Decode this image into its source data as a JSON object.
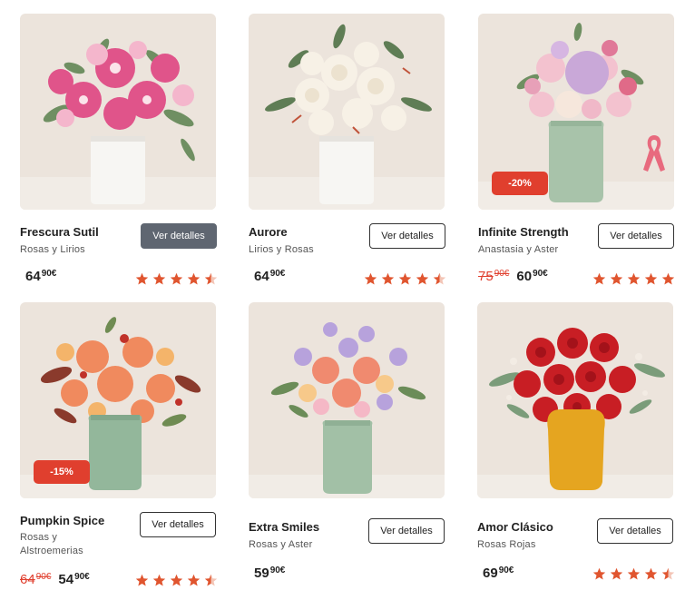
{
  "colors": {
    "accent": "#e03f2e",
    "star": "#e0552f",
    "button_active": "#5f6671"
  },
  "products": [
    {
      "title": "Frescura Sutil",
      "subtitle": "Rosas y Lirios",
      "button": "Ver detalles",
      "button_active": true,
      "price": {
        "int": "64",
        "cents": "90€"
      },
      "rating": 4.5,
      "vase": "white",
      "flowers": "pink-lilies"
    },
    {
      "title": "Aurore",
      "subtitle": "Lirios y Rosas",
      "button": "Ver detalles",
      "button_active": false,
      "price": {
        "int": "64",
        "cents": "90€"
      },
      "rating": 4.5,
      "vase": "white",
      "flowers": "white-roses"
    },
    {
      "title": "Infinite Strength",
      "subtitle": "Anastasia y Aster",
      "button": "Ver detalles",
      "button_active": false,
      "badge": "-20%",
      "old_price": {
        "int": "75",
        "cents": "90€"
      },
      "price": {
        "int": "60",
        "cents": "90€"
      },
      "rating": 5,
      "vase": "sage",
      "flowers": "pastel-mix",
      "ribbon_icon": "pink-ribbon-icon"
    },
    {
      "title": "Pumpkin Spice",
      "subtitle": "Rosas y Alstroemerias",
      "button": "Ver detalles",
      "button_active": false,
      "badge": "-15%",
      "old_price": {
        "int": "64",
        "cents": "90€"
      },
      "price": {
        "int": "54",
        "cents": "90€"
      },
      "rating": 4.5,
      "vase": "sage",
      "flowers": "orange-autumn"
    },
    {
      "title": "Extra Smiles",
      "subtitle": "Rosas y Aster",
      "button": "Ver detalles",
      "button_active": false,
      "price": {
        "int": "59",
        "cents": "90€"
      },
      "rating": null,
      "vase": "sage",
      "flowers": "lilac-coral"
    },
    {
      "title": "Amor Clásico",
      "subtitle": "Rosas Rojas",
      "button": "Ver detalles",
      "button_active": false,
      "price": {
        "int": "69",
        "cents": "90€"
      },
      "rating": 4.5,
      "vase": "mustard",
      "flowers": "red-roses"
    }
  ]
}
